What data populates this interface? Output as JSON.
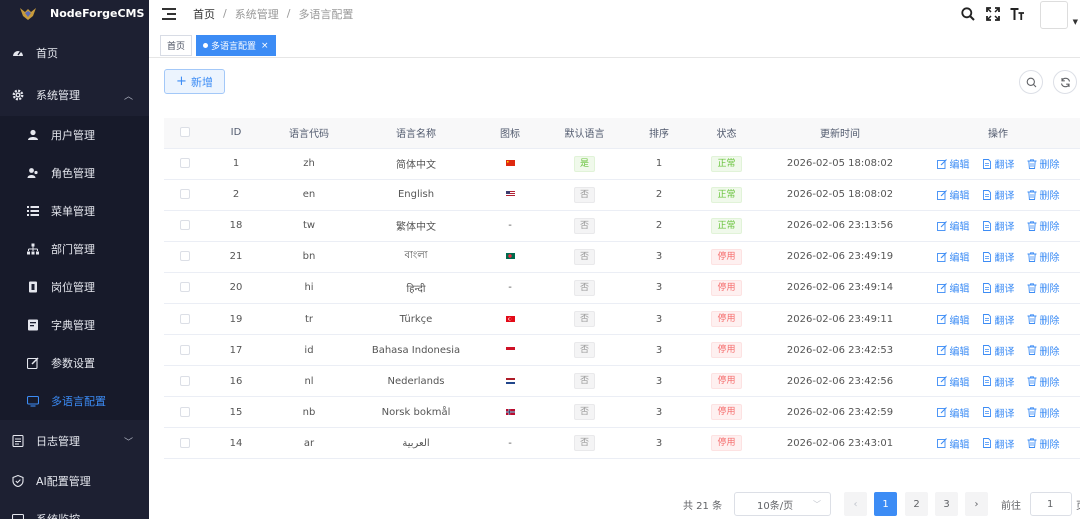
{
  "app": {
    "name": "NodeForgeCMS"
  },
  "sidebar": {
    "items": [
      {
        "label": "首页",
        "icon": "dashboard-icon"
      },
      {
        "label": "系统管理",
        "icon": "gear-icon"
      },
      {
        "label": "用户管理",
        "icon": "user-icon"
      },
      {
        "label": "角色管理",
        "icon": "role-icon"
      },
      {
        "label": "菜单管理",
        "icon": "menu-list-icon"
      },
      {
        "label": "部门管理",
        "icon": "org-tree-icon"
      },
      {
        "label": "岗位管理",
        "icon": "post-icon"
      },
      {
        "label": "字典管理",
        "icon": "dictionary-icon"
      },
      {
        "label": "参数设置",
        "icon": "edit-icon"
      },
      {
        "label": "多语言配置",
        "icon": "monitor-icon"
      },
      {
        "label": "日志管理",
        "icon": "log-icon"
      },
      {
        "label": "AI配置管理",
        "icon": "shield-icon"
      },
      {
        "label": "系统监控",
        "icon": "monitor-icon"
      }
    ]
  },
  "header": {
    "breadcrumb": [
      "首页",
      "系统管理",
      "多语言配置"
    ]
  },
  "tabs": [
    {
      "label": "首页"
    },
    {
      "label": "多语言配置"
    }
  ],
  "toolbar": {
    "add_label": "新增"
  },
  "table": {
    "columns": [
      "ID",
      "语言代码",
      "语言名称",
      "图标",
      "默认语言",
      "排序",
      "状态",
      "更新时间",
      "操作"
    ],
    "rows": [
      {
        "id": "1",
        "code": "zh",
        "name": "简体中文",
        "flag": "cn",
        "default": "是",
        "sort": "1",
        "status": "正常",
        "updated": "2026-02-05 18:08:02"
      },
      {
        "id": "2",
        "code": "en",
        "name": "English",
        "flag": "us",
        "default": "否",
        "sort": "2",
        "status": "正常",
        "updated": "2026-02-05 18:08:02"
      },
      {
        "id": "18",
        "code": "tw",
        "name": "繁体中文",
        "flag": "-",
        "default": "否",
        "sort": "2",
        "status": "正常",
        "updated": "2026-02-06 23:13:56"
      },
      {
        "id": "21",
        "code": "bn",
        "name": "বাংলা",
        "flag": "bd",
        "default": "否",
        "sort": "3",
        "status": "停用",
        "updated": "2026-02-06 23:49:19"
      },
      {
        "id": "20",
        "code": "hi",
        "name": "हिन्दी",
        "flag": "-",
        "default": "否",
        "sort": "3",
        "status": "停用",
        "updated": "2026-02-06 23:49:14"
      },
      {
        "id": "19",
        "code": "tr",
        "name": "Türkçe",
        "flag": "tr",
        "default": "否",
        "sort": "3",
        "status": "停用",
        "updated": "2026-02-06 23:49:11"
      },
      {
        "id": "17",
        "code": "id",
        "name": "Bahasa Indonesia",
        "flag": "id",
        "default": "否",
        "sort": "3",
        "status": "停用",
        "updated": "2026-02-06 23:42:53"
      },
      {
        "id": "16",
        "code": "nl",
        "name": "Nederlands",
        "flag": "nl",
        "default": "否",
        "sort": "3",
        "status": "停用",
        "updated": "2026-02-06 23:42:56"
      },
      {
        "id": "15",
        "code": "nb",
        "name": "Norsk bokmål",
        "flag": "no",
        "default": "否",
        "sort": "3",
        "status": "停用",
        "updated": "2026-02-06 23:42:59"
      },
      {
        "id": "14",
        "code": "ar",
        "name": "العربية",
        "flag": "-",
        "default": "否",
        "sort": "3",
        "status": "停用",
        "updated": "2026-02-06 23:43:01"
      }
    ],
    "actions": {
      "edit": "编辑",
      "translate": "翻译",
      "delete": "删除"
    }
  },
  "pagination": {
    "total_text": "共 21 条",
    "page_size": "10条/页",
    "pages": [
      "1",
      "2",
      "3"
    ],
    "current": "1",
    "goto_label": "前往",
    "goto_value": "1"
  },
  "colors": {
    "primary": "#3c8cf5",
    "sidebar_bg": "#1d2032",
    "success": "#67c23a",
    "danger": "#f56c6c"
  }
}
